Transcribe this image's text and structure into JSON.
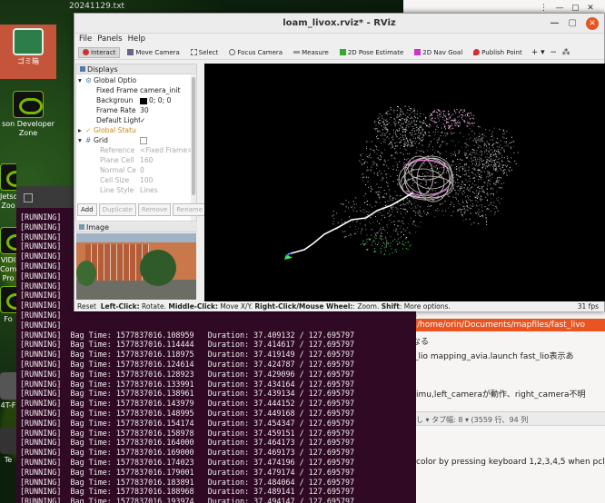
{
  "desktop": {
    "bg_title": "20241129.txt",
    "icons": [
      {
        "label": "ゴミ箱"
      },
      {
        "label": "son Developer Zone"
      },
      {
        "label": "Jetson Zoo"
      },
      {
        "label": "VIDI Com Pro"
      },
      {
        "label": "Fo"
      },
      {
        "label": "4T-F"
      },
      {
        "label": "Te"
      }
    ]
  },
  "rviz": {
    "title": "loam_livox.rviz* - RViz",
    "menu": [
      "File",
      "Panels",
      "Help"
    ],
    "toolbar": [
      "Interact",
      "Move Camera",
      "Select",
      "Focus Camera",
      "Measure",
      "2D Pose Estimate",
      "2D Nav Goal",
      "Publish Point"
    ],
    "displays": {
      "header": "Displays",
      "rows": [
        {
          "key": "Global Optio",
          "value": ""
        },
        {
          "key": "Fixed Frame",
          "value": "camera_init"
        },
        {
          "key": "Backgroun",
          "value": "0; 0; 0"
        },
        {
          "key": "Frame Rate",
          "value": "30"
        },
        {
          "key": "Default Light",
          "value": "✓"
        },
        {
          "key": "Global Statu",
          "value": ""
        },
        {
          "key": "Grid",
          "value": ""
        },
        {
          "key": "Reference",
          "value": "<Fixed Frame>"
        },
        {
          "key": "Plane Cell",
          "value": "160"
        },
        {
          "key": "Normal Ce",
          "value": "0"
        },
        {
          "key": "Cell Size",
          "value": "100"
        },
        {
          "key": "Line Style",
          "value": "Lines"
        }
      ]
    },
    "panel_buttons": [
      "Add",
      "Duplicate",
      "Remove",
      "Rename"
    ],
    "image_panel": "Image",
    "status": {
      "reset": "Reset",
      "left": "Left-Click:",
      "left_desc": " Rotate. ",
      "middle": "Middle-Click:",
      "middle_desc": " Move X/Y. ",
      "right": "Right-Click/Mouse Wheel:",
      "right_desc": ": Zoom. ",
      "shift": "Shift",
      "shift_desc": ": More options.",
      "fps": "31 fps"
    }
  },
  "terminal": {
    "rows": [
      "[RUNNING]",
      "[RUNNING]",
      "[RUNNING]",
      "[RUNNING]",
      "[RUNNING]",
      "[RUNNING]",
      "[RUNNING]",
      "[RUNNING]",
      "[RUNNING]",
      "[RUNNING]",
      "[RUNNING]",
      "[RUNNING]",
      "[RUNNING]  Bag Time: 1577837016.108959   Duration: 37.409132 / 127.695797",
      "[RUNNING]  Bag Time: 1577837016.114444   Duration: 37.414617 / 127.695797",
      "[RUNNING]  Bag Time: 1577837016.118975   Duration: 37.419149 / 127.695797",
      "[RUNNING]  Bag Time: 1577837016.124614   Duration: 37.424787 / 127.695797",
      "[RUNNING]  Bag Time: 1577837016.128923   Duration: 37.429096 / 127.695797",
      "[RUNNING]  Bag Time: 1577837016.133991   Duration: 37.434164 / 127.695797",
      "[RUNNING]  Bag Time: 1577837016.138961   Duration: 37.439134 / 127.695797",
      "[RUNNING]  Bag Time: 1577837016.143979   Duration: 37.444152 / 127.695797",
      "[RUNNING]  Bag Time: 1577837016.148995   Duration: 37.449168 / 127.695797",
      "[RUNNING]  Bag Time: 1577837016.154174   Duration: 37.454347 / 127.695797",
      "[RUNNING]  Bag Time: 1577837016.158978   Duration: 37.459151 / 127.695797",
      "[RUNNING]  Bag Time: 1577837016.164000   Duration: 37.464173 / 127.695797",
      "[RUNNING]  Bag Time: 1577837016.169000   Duration: 37.469173 / 127.695797",
      "[RUNNING]  Bag Time: 1577837016.174023   Duration: 37.474196 / 127.695797",
      "[RUNNING]  Bag Time: 1577837016.179001   Duration: 37.479174 / 127.695797",
      "[RUNNING]  Bag Time: 1577837016.183891   Duration: 37.484064 / 127.695797",
      "[RUNNING]  Bag Time: 1577837016.188968   Duration: 37.489141 / 127.695797",
      "[RUNNING]  Bag Time: 1577837016.193974   Duration: 37.494147 / 127.695797",
      "[RUNNING]  Bag Time: 1577837016.199828   Duration: 37.500001 / 127.695797"
    ]
  },
  "editor": {
    "path": "/home/orin/Documents/mapfiles/fast_livo",
    "line_naru": "なる",
    "line_lio": "_lio mapping_avia.launch  fast_lio表示あ",
    "line_imu": "imu,left_cameraが動作、right_camera不明",
    "status": "なし ▾  タブ幅: 8 ▾     (3559 行、94 列",
    "line_color": "color by pressing keyboard 1,2,3,4,5 when pcl_view"
  }
}
